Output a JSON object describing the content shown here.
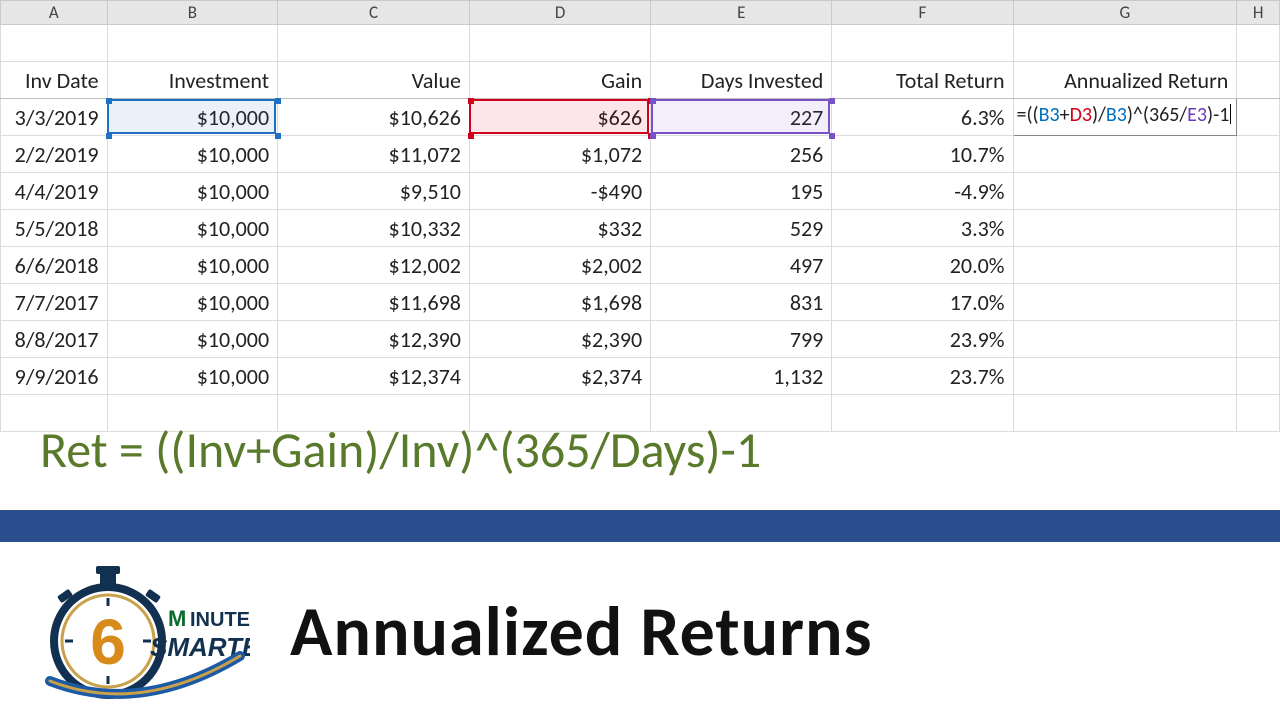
{
  "columns": [
    "A",
    "B",
    "C",
    "D",
    "E",
    "F",
    "G",
    "H"
  ],
  "headers": {
    "A": "Inv Date",
    "B": "Investment",
    "C": "Value",
    "D": "Gain",
    "E": "Days Invested",
    "F": "Total Return",
    "G": "Annualized Return"
  },
  "rows": [
    {
      "A": "3/3/2019",
      "B": "$10,000",
      "C": "$10,626",
      "D": "$626",
      "E": "227",
      "F": "6.3%",
      "G_formula": true
    },
    {
      "A": "2/2/2019",
      "B": "$10,000",
      "C": "$11,072",
      "D": "$1,072",
      "E": "256",
      "F": "10.7%"
    },
    {
      "A": "4/4/2019",
      "B": "$10,000",
      "C": "$9,510",
      "D": "-$490",
      "E": "195",
      "F": "-4.9%"
    },
    {
      "A": "5/5/2018",
      "B": "$10,000",
      "C": "$10,332",
      "D": "$332",
      "E": "529",
      "F": "3.3%"
    },
    {
      "A": "6/6/2018",
      "B": "$10,000",
      "C": "$12,002",
      "D": "$2,002",
      "E": "497",
      "F": "20.0%"
    },
    {
      "A": "7/7/2017",
      "B": "$10,000",
      "C": "$11,698",
      "D": "$1,698",
      "E": "831",
      "F": "17.0%"
    },
    {
      "A": "8/8/2017",
      "B": "$10,000",
      "C": "$12,390",
      "D": "$2,390",
      "E": "799",
      "F": "23.9%"
    },
    {
      "A": "9/9/2016",
      "B": "$10,000",
      "C": "$12,374",
      "D": "$2,374",
      "E": "1,132",
      "F": "23.7%"
    }
  ],
  "formula": {
    "prefix": "=((",
    "b1": "B3",
    "plus": "+",
    "d3": "D3",
    "paren1": ")/",
    "b2": "B3",
    "paren2": ")^(365/",
    "e3": "E3",
    "suffix": ")-1"
  },
  "ref_colors": {
    "B3": "#1f6fc2",
    "D3": "#d1001c",
    "E3": "#7a52c7"
  },
  "equation_text": "Ret = ((Inv+Gain)/Inv)^(365/Days)-1",
  "footer": {
    "title": "Annualized Returns",
    "brand_top": "INUTES",
    "brand_bottom": "SMARTER",
    "brand_digit": "6"
  }
}
